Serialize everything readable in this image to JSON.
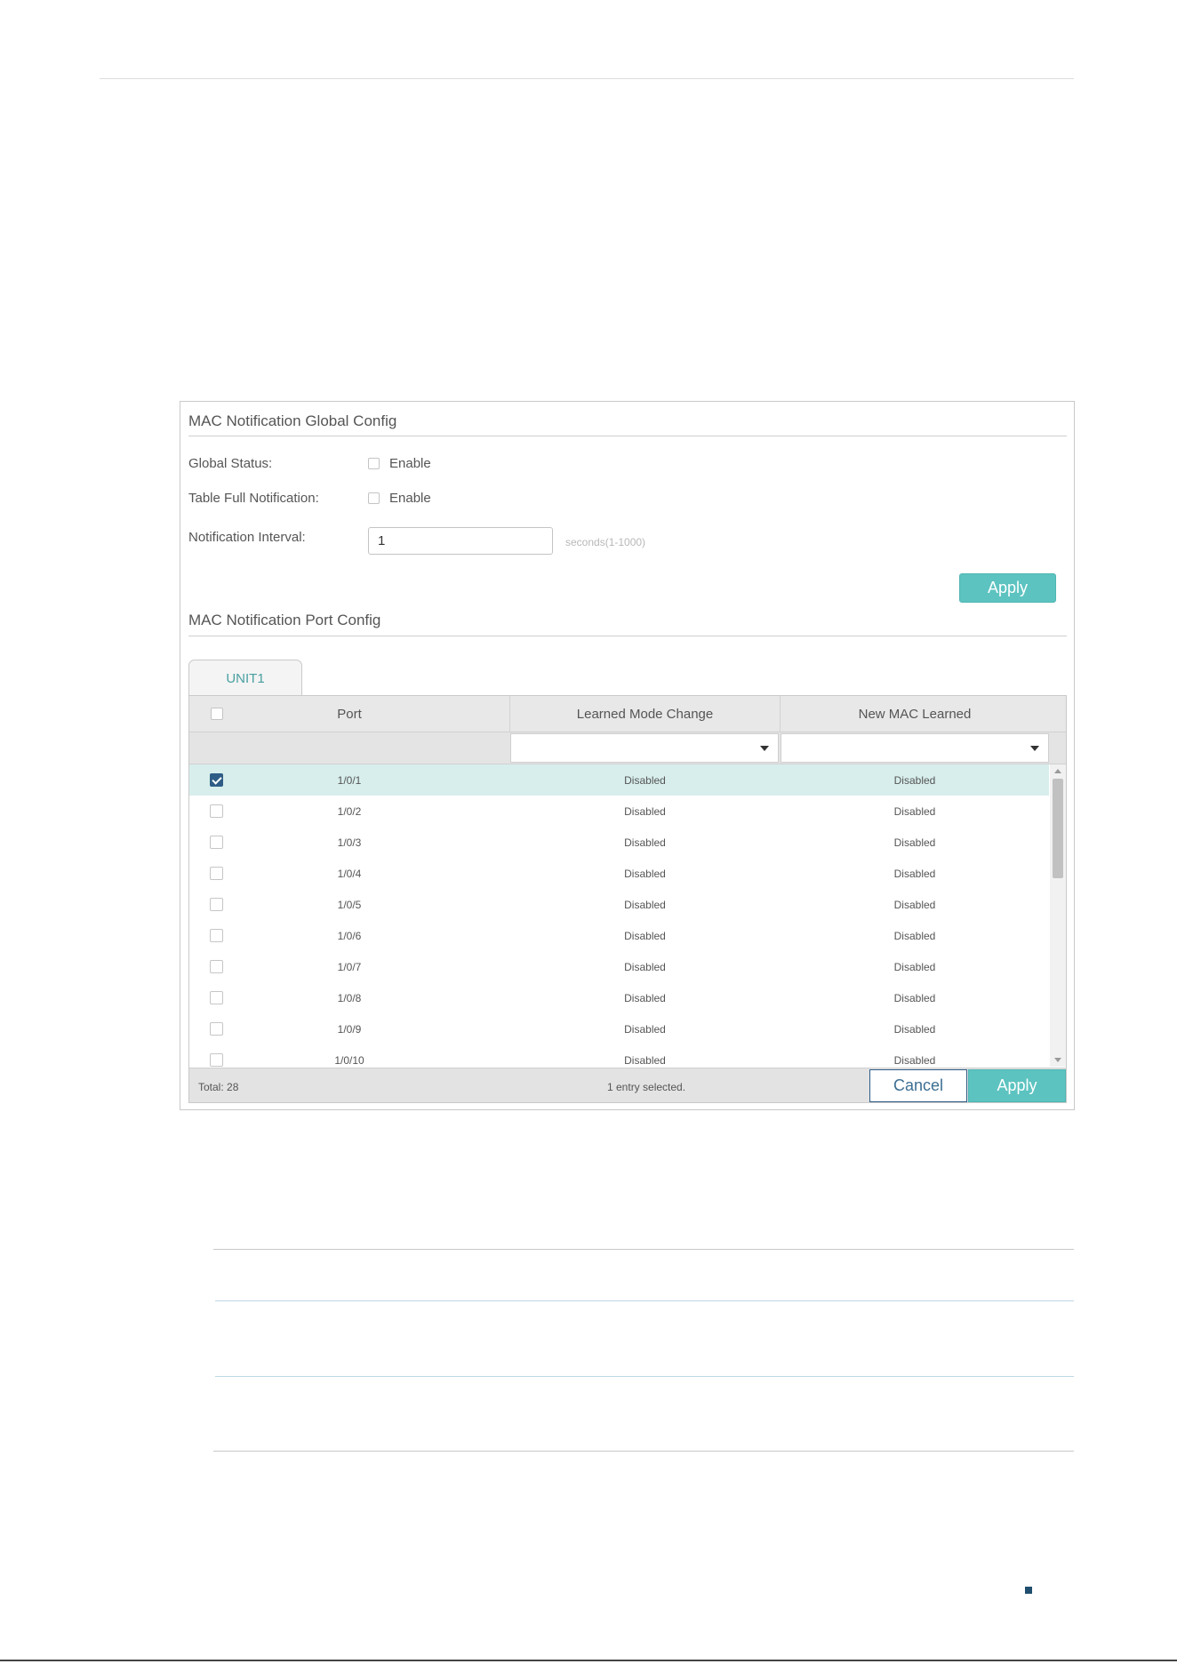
{
  "global_config": {
    "title": "MAC Notification Global Config",
    "global_status_label": "Global Status:",
    "global_status_option": "Enable",
    "table_full_label": "Table Full Notification:",
    "table_full_option": "Enable",
    "interval_label": "Notification Interval:",
    "interval_value": "1",
    "interval_hint": "seconds(1-1000)",
    "apply_label": "Apply"
  },
  "port_config": {
    "title": "MAC Notification Port Config",
    "tab_label": "UNIT1",
    "columns": [
      "Port",
      "Learned Mode Change",
      "New MAC Learned"
    ],
    "rows": [
      {
        "port": "1/0/1",
        "learned_mode_change": "Disabled",
        "new_mac_learned": "Disabled",
        "selected": true
      },
      {
        "port": "1/0/2",
        "learned_mode_change": "Disabled",
        "new_mac_learned": "Disabled",
        "selected": false
      },
      {
        "port": "1/0/3",
        "learned_mode_change": "Disabled",
        "new_mac_learned": "Disabled",
        "selected": false
      },
      {
        "port": "1/0/4",
        "learned_mode_change": "Disabled",
        "new_mac_learned": "Disabled",
        "selected": false
      },
      {
        "port": "1/0/5",
        "learned_mode_change": "Disabled",
        "new_mac_learned": "Disabled",
        "selected": false
      },
      {
        "port": "1/0/6",
        "learned_mode_change": "Disabled",
        "new_mac_learned": "Disabled",
        "selected": false
      },
      {
        "port": "1/0/7",
        "learned_mode_change": "Disabled",
        "new_mac_learned": "Disabled",
        "selected": false
      },
      {
        "port": "1/0/8",
        "learned_mode_change": "Disabled",
        "new_mac_learned": "Disabled",
        "selected": false
      },
      {
        "port": "1/0/9",
        "learned_mode_change": "Disabled",
        "new_mac_learned": "Disabled",
        "selected": false
      },
      {
        "port": "1/0/10",
        "learned_mode_change": "Disabled",
        "new_mac_learned": "Disabled",
        "selected": false
      }
    ],
    "total_text": "Total: 28",
    "selection_text": "1 entry selected.",
    "cancel_label": "Cancel",
    "apply_label": "Apply"
  },
  "colors": {
    "accent_teal": "#5cc3c0",
    "checkbox_checked": "#2e5c86",
    "selected_row": "#d7eeec"
  }
}
